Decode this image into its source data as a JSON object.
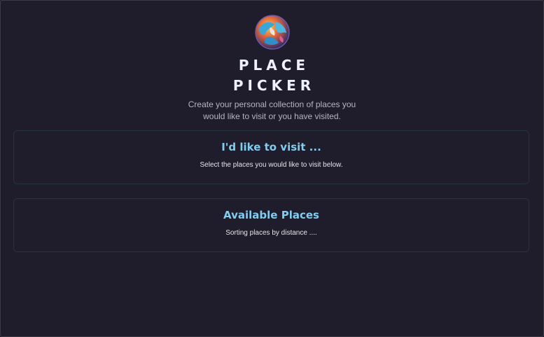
{
  "header": {
    "logo_icon": "globe-logo-icon",
    "title_line1": "PLACE",
    "title_line2": "PICKER",
    "subtitle": "Create your personal collection of places you would like to visit or you have visited."
  },
  "sections": {
    "visit": {
      "heading": "I'd like to visit ...",
      "text": "Select the places you would like to visit below."
    },
    "available": {
      "heading": "Available Places",
      "text": "Sorting places by distance ...."
    }
  },
  "colors": {
    "background": "#1f1d2b",
    "heading_accent": "#7fcdf0",
    "card_border": "#23343d"
  }
}
